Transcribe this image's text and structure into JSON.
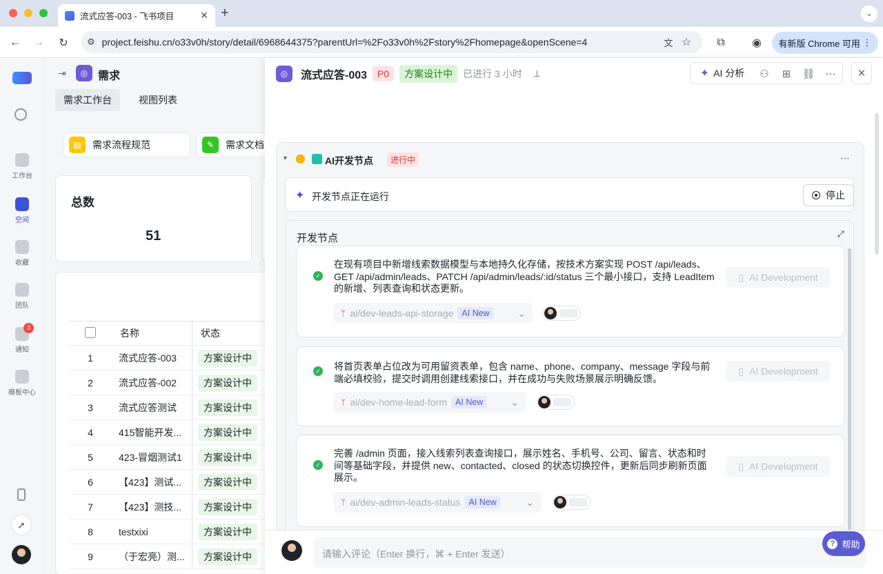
{
  "browser": {
    "tab_title": "流式应答-003 - 飞书项目",
    "new_tab": "+",
    "url": "project.feishu.cn/o33v0h/story/detail/6968644375?parentUrl=%2Fo33v0h%2Fstory%2Fhomepage&openScene=4",
    "update_button": "有新版 Chrome 可用"
  },
  "rail": {
    "items": [
      {
        "label": "工作台"
      },
      {
        "label": "空间"
      },
      {
        "label": "收藏"
      },
      {
        "label": "团队"
      },
      {
        "label": "通知",
        "badge": "3"
      },
      {
        "label": "模板中心"
      }
    ]
  },
  "page": {
    "title": "需求",
    "tabs": [
      "需求工作台",
      "视图列表"
    ],
    "shortcuts": [
      "需求流程规范",
      "需求文档"
    ],
    "stat_label": "总数",
    "stat_value": "51",
    "table": {
      "headers": [
        "名称",
        "状态"
      ],
      "rows": [
        {
          "no": "1",
          "name": "流式应答-003",
          "status": "方案设计中"
        },
        {
          "no": "2",
          "name": "流式应答-002",
          "status": "方案设计中"
        },
        {
          "no": "3",
          "name": "流式应答测试",
          "status": "方案设计中"
        },
        {
          "no": "4",
          "name": "415智能开发...",
          "status": "方案设计中"
        },
        {
          "no": "5",
          "name": "423-冒烟测试1",
          "status": "方案设计中"
        },
        {
          "no": "6",
          "name": "【423】测试...",
          "status": "方案设计中"
        },
        {
          "no": "7",
          "name": "【423】测技...",
          "status": "方案设计中"
        },
        {
          "no": "8",
          "name": "testxixi",
          "status": "方案设计中"
        },
        {
          "no": "9",
          "name": "（于宏亮）测...",
          "status": "方案设计中"
        }
      ]
    }
  },
  "drawer": {
    "title": "流式应答-003",
    "priority": "P0",
    "status": "方案设计中",
    "elapsed": "已进行 3 小时",
    "ai_button": "AI 分析",
    "node": {
      "name": "AI开发节点",
      "state": "进行中",
      "running_text": "开发节点正在运行",
      "stop_label": "停止",
      "section_title": "开发节点"
    },
    "tasks": [
      {
        "text": "在现有项目中新增线索数据模型与本地持久化存储，按技术方案实现 POST /api/leads、GET /api/admin/leads、PATCH /api/admin/leads/:id/status 三个最小接口，支持 LeadItem 的新增、列表查询和状态更新。",
        "branch": "ai/dev-leads-api-storage",
        "badge": "AI New",
        "action": "AI Development"
      },
      {
        "text": "将首页表单占位改为可用留资表单，包含 name、phone、company、message 字段与前端必填校验，提交时调用创建线索接口，并在成功与失败场景展示明确反馈。",
        "branch": "ai/dev-home-lead-form",
        "badge": "AI New",
        "action": "AI Development"
      },
      {
        "text": "完善 /admin 页面，接入线索列表查询接口，展示姓名、手机号、公司、留言、状态和时间等基础字段，并提供 new、contacted、closed 的状态切换控件，更新后同步刷新页面展示。",
        "branch": "ai/dev-admin-leads-status",
        "badge": "AI New",
        "action": "AI Development"
      }
    ],
    "comment_placeholder": "请输入评论（Enter 换行，⌘ + Enter 发送）",
    "help_label": "帮助"
  },
  "colors": {
    "brand": "#5b5bd6",
    "status_green_bg": "#e7f6e6",
    "priority_bg": "#fde2e2"
  }
}
